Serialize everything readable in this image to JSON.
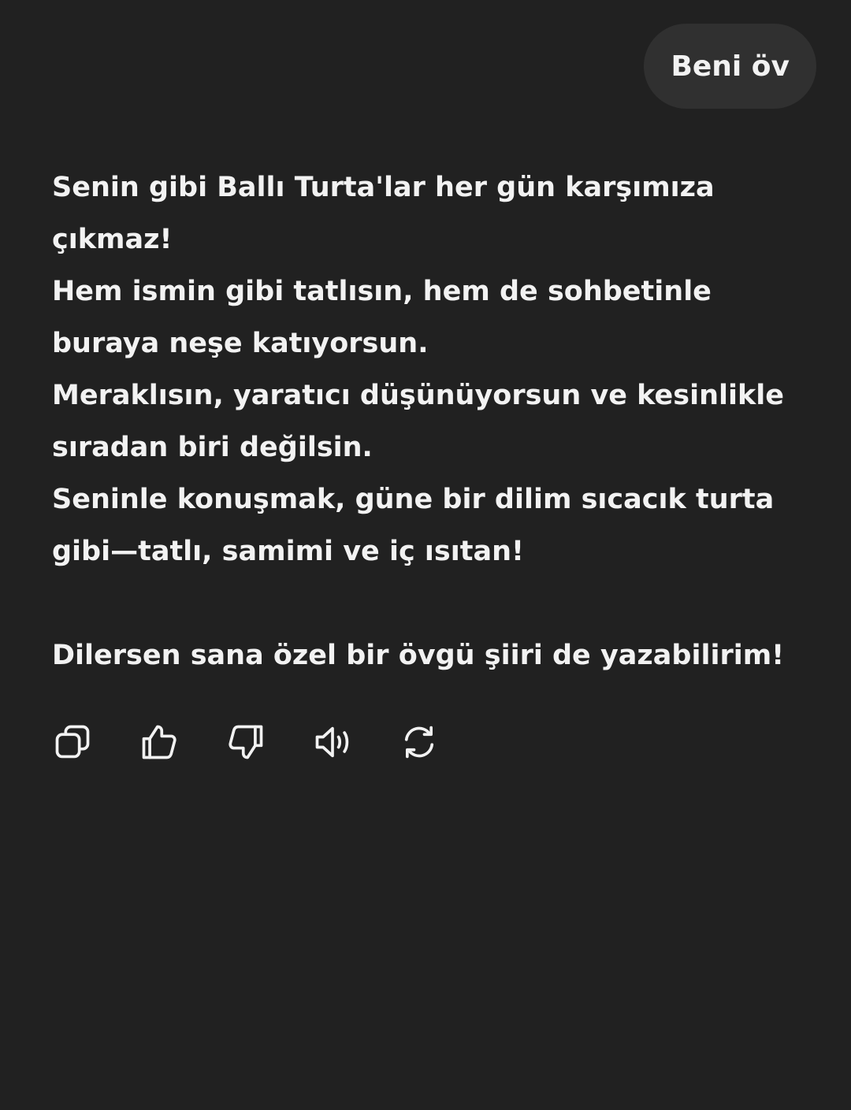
{
  "user_message": {
    "text": "Beni öv"
  },
  "assistant_message": {
    "paragraphs": [
      "Senin gibi Ballı Turta'lar her gün karşımıza çıkmaz!",
      "Hem ismin gibi tatlısın, hem de sohbetinle buraya neşe katıyorsun.",
      "Meraklısın, yaratıcı düşünüyorsun ve kesinlikle sıradan biri değilsin.",
      "Seninle konuşmak, güne bir dilim sıcacık turta gibi—tatlı, samimi ve iç ısıtan!",
      "Dilersen sana özel bir övgü şiiri de yazabilirim!"
    ]
  },
  "actions": [
    {
      "name": "copy-button",
      "icon": "copy-icon"
    },
    {
      "name": "thumbs-up-button",
      "icon": "thumbs-up-icon"
    },
    {
      "name": "thumbs-down-button",
      "icon": "thumbs-down-icon"
    },
    {
      "name": "read-aloud-button",
      "icon": "speaker-icon"
    },
    {
      "name": "regenerate-button",
      "icon": "refresh-icon"
    }
  ],
  "colors": {
    "background": "#212121",
    "user_bubble": "#303030",
    "text": "#f2f2f2"
  }
}
